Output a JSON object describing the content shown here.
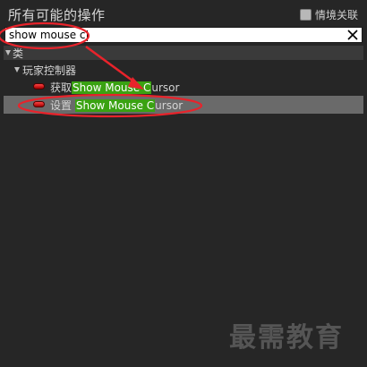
{
  "header": {
    "title": "所有可能的操作",
    "context_checkbox_label": "情境关联"
  },
  "search": {
    "value": "show mouse c"
  },
  "tree": {
    "category_class": "类",
    "category_player_controller": "玩家控制器",
    "items": [
      {
        "prefix": "获取",
        "match": "Show Mouse C",
        "rest": "ursor"
      },
      {
        "prefix": "设置",
        "match": "Show Mouse C",
        "rest": "ursor"
      }
    ]
  },
  "colors": {
    "background": "#262626",
    "match_highlight": "#3aa212",
    "selected_row": "#6a6a6a",
    "annotation": "#e8232b"
  },
  "icons": {
    "clear": "close-icon",
    "node": "function-pill-icon",
    "expand": "expand-triangle-icon"
  },
  "watermark": "最需教育"
}
